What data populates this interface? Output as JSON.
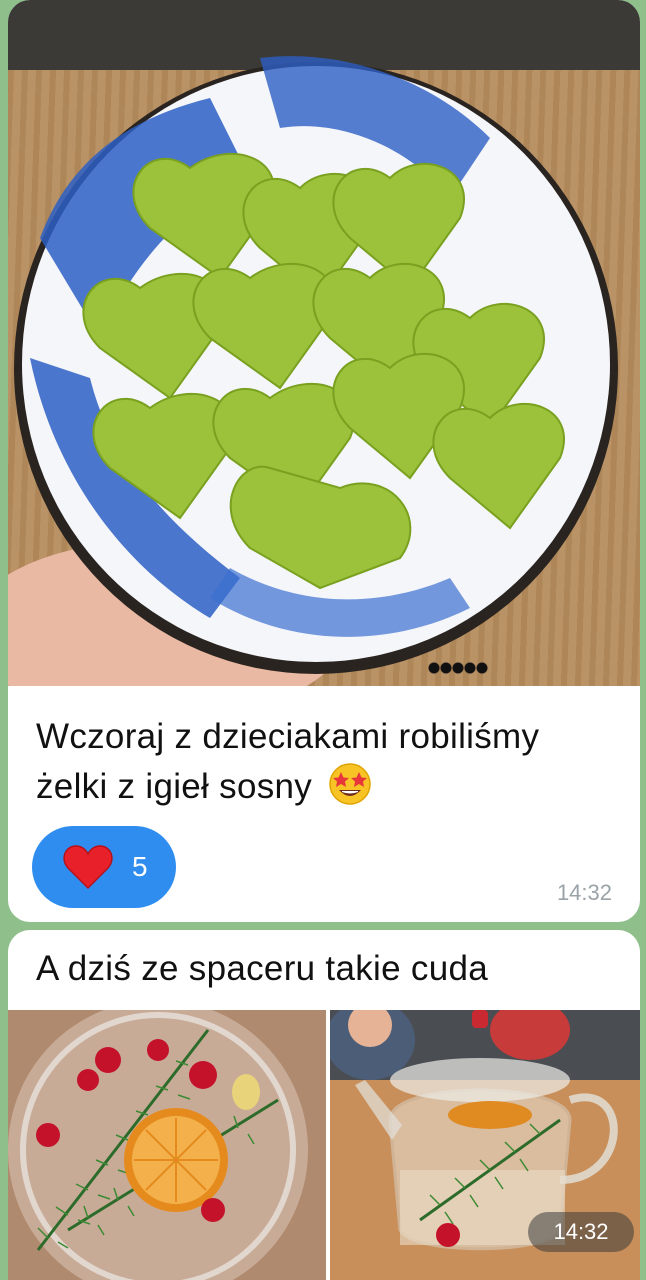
{
  "messages": [
    {
      "text_line1": "Wczoraj z dzieciakami robiliśmy",
      "text_line2": "żelki z igieł sosny",
      "emoji": "star-struck-emoji",
      "reaction": {
        "icon": "heart-icon",
        "count": "5"
      },
      "time": "14:32"
    },
    {
      "text": "A dziś ze spaceru takie cuda",
      "time": "14:32"
    }
  ],
  "colors": {
    "reaction_bg": "#2f8df0",
    "bubble_bg": "#ffffff",
    "chat_bg": "#8fbf8a",
    "time_text": "#9aa3a8"
  }
}
